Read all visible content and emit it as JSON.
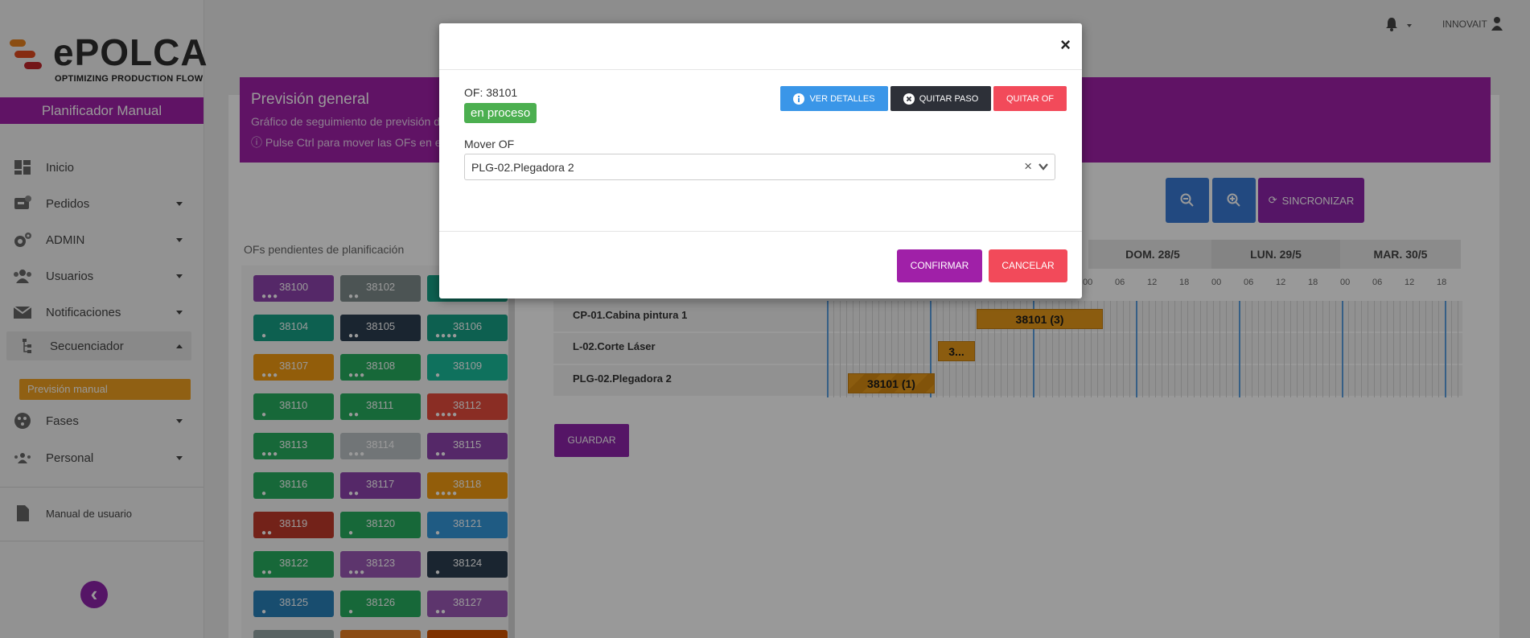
{
  "brand": {
    "name": "ePOLCA",
    "tagline": "OPTIMIZING PRODUCTION FLOW"
  },
  "sidebar": {
    "planner_title": "Planificador Manual",
    "items": [
      {
        "label": "Inicio"
      },
      {
        "label": "Pedidos"
      },
      {
        "label": "ADMIN"
      },
      {
        "label": "Usuarios"
      },
      {
        "label": "Notificaciones"
      },
      {
        "label": "Secuenciador"
      },
      {
        "label": "Fases"
      },
      {
        "label": "Personal"
      }
    ],
    "sub_item": "Previsión manual",
    "manual": "Manual de usuario"
  },
  "topbar": {
    "user": "INNOVAIT"
  },
  "header": {
    "title": "Previsión general",
    "subtitle": "Gráfico de seguimiento de previsión de",
    "info": "Pulse Ctrl para mover las OFs en el"
  },
  "pending": {
    "title": "OFs pendientes de planificación",
    "chips": [
      {
        "num": "38100",
        "color": "#8e44ad",
        "dots": "●●●"
      },
      {
        "num": "38102",
        "color": "#7f8c8d",
        "dots": "●●"
      },
      {
        "num": "",
        "color": "#16a085",
        "dots": ""
      },
      {
        "num": "38104",
        "color": "#16a085",
        "dots": "●"
      },
      {
        "num": "38105",
        "color": "#2c3e50",
        "dots": "●●"
      },
      {
        "num": "38106",
        "color": "#16a085",
        "dots": "●●●●"
      },
      {
        "num": "38107",
        "color": "#f39c12",
        "dots": "●●●"
      },
      {
        "num": "38108",
        "color": "#27ae60",
        "dots": "●●●"
      },
      {
        "num": "38109",
        "color": "#1abc9c",
        "dots": "●"
      },
      {
        "num": "38110",
        "color": "#27ae60",
        "dots": "●"
      },
      {
        "num": "38111",
        "color": "#27ae60",
        "dots": "●●"
      },
      {
        "num": "38112",
        "color": "#e74c3c",
        "dots": "●●●●"
      },
      {
        "num": "38113",
        "color": "#27ae60",
        "dots": "●●●"
      },
      {
        "num": "38114",
        "color": "#bdc3c7",
        "dots": "●●●"
      },
      {
        "num": "38115",
        "color": "#8e44ad",
        "dots": "●●"
      },
      {
        "num": "38116",
        "color": "#27ae60",
        "dots": "●"
      },
      {
        "num": "38117",
        "color": "#8e44ad",
        "dots": "●●"
      },
      {
        "num": "38118",
        "color": "#f39c12",
        "dots": "●●●●"
      },
      {
        "num": "38119",
        "color": "#c0392b",
        "dots": "●●"
      },
      {
        "num": "38120",
        "color": "#27ae60",
        "dots": "●"
      },
      {
        "num": "38121",
        "color": "#3498db",
        "dots": "●"
      },
      {
        "num": "38122",
        "color": "#27ae60",
        "dots": "●●"
      },
      {
        "num": "38123",
        "color": "#9b59b6",
        "dots": "●●●"
      },
      {
        "num": "38124",
        "color": "#2c3e50",
        "dots": "●"
      },
      {
        "num": "38125",
        "color": "#2980b9",
        "dots": "●"
      },
      {
        "num": "38126",
        "color": "#27ae60",
        "dots": "●"
      },
      {
        "num": "38127",
        "color": "#9b59b6",
        "dots": "●●"
      },
      {
        "num": "",
        "color": "#95a5a6",
        "dots": ""
      },
      {
        "num": "",
        "color": "#e67e22",
        "dots": ""
      },
      {
        "num": "",
        "color": "#d35400",
        "dots": ""
      }
    ]
  },
  "toolbar": {
    "sync_label": "SINCRONIZAR"
  },
  "timeline": {
    "days": [
      "DOM. 28/5",
      "LUN. 29/5",
      "MAR. 30/5"
    ],
    "hours": [
      "00",
      "06",
      "12",
      "18"
    ],
    "rows": [
      {
        "label": "CP-01.Cabina pintura 1"
      },
      {
        "label": "L-02.Corte Láser"
      },
      {
        "label": "PLG-02.Plegadora 2"
      }
    ],
    "tasks": [
      {
        "label": "38101 (3)",
        "row": 0
      },
      {
        "label": "3...",
        "row": 1
      },
      {
        "label": "38101 (1)",
        "row": 2
      }
    ]
  },
  "save_label": "GUARDAR",
  "modal": {
    "of_label": "OF: 38101",
    "status": "en proceso",
    "details_label": "VER DETALLES",
    "remove_step_label": "QUITAR PASO",
    "remove_of_label": "QUITAR OF",
    "move_label": "Mover OF",
    "move_value": "PLG-02.Plegadora 2",
    "confirm_label": "CONFIRMAR",
    "cancel_label": "CANCELAR",
    "close_glyph": "×"
  }
}
